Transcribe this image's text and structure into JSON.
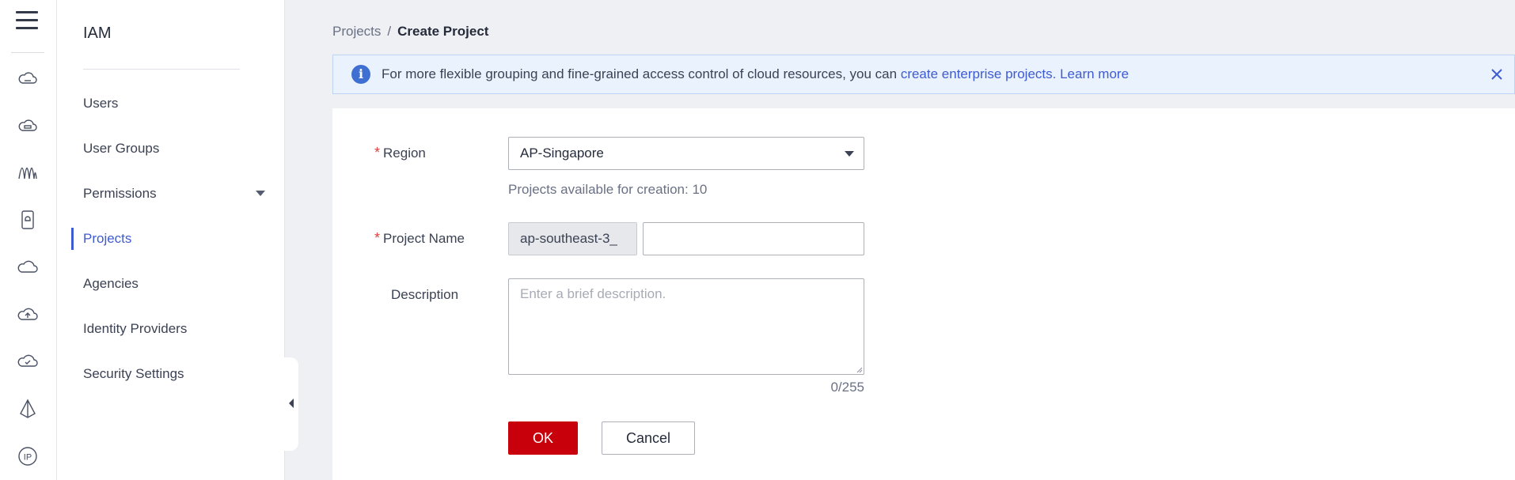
{
  "rail": {
    "icons": [
      "menu-icon",
      "cloud-server-icon",
      "cloud-database-icon",
      "network-waves-icon",
      "device-icon",
      "cloud-icon",
      "cloud-upload-icon",
      "cloud-check-icon",
      "pyramid-icon",
      "ip-icon"
    ],
    "ip_label": "IP"
  },
  "sidebar": {
    "title": "IAM",
    "items": [
      {
        "label": "Users"
      },
      {
        "label": "User Groups"
      },
      {
        "label": "Permissions"
      },
      {
        "label": "Projects"
      },
      {
        "label": "Agencies"
      },
      {
        "label": "Identity Providers"
      },
      {
        "label": "Security Settings"
      }
    ],
    "active_index": 3
  },
  "breadcrumb": {
    "parent": "Projects",
    "separator": "/",
    "current": "Create Project"
  },
  "banner": {
    "text": "For more flexible grouping and fine-grained access control of cloud resources, you can",
    "link_create": "create enterprise projects.",
    "link_learn": "Learn more"
  },
  "form": {
    "region_label": "Region",
    "region_value": "AP-Singapore",
    "availability_hint": "Projects available for creation: 10",
    "project_name_label": "Project Name",
    "project_name_prefix": "ap-southeast-3_",
    "project_name_value": "",
    "description_label": "Description",
    "description_placeholder": "Enter a brief description.",
    "char_count": "0/255",
    "required_mark": "*"
  },
  "buttons": {
    "ok": "OK",
    "cancel": "Cancel"
  },
  "colors": {
    "accent": "#3e5bd1",
    "primary_button": "#c7000b",
    "required": "#e0403f",
    "banner_bg": "#eaf2fd"
  }
}
